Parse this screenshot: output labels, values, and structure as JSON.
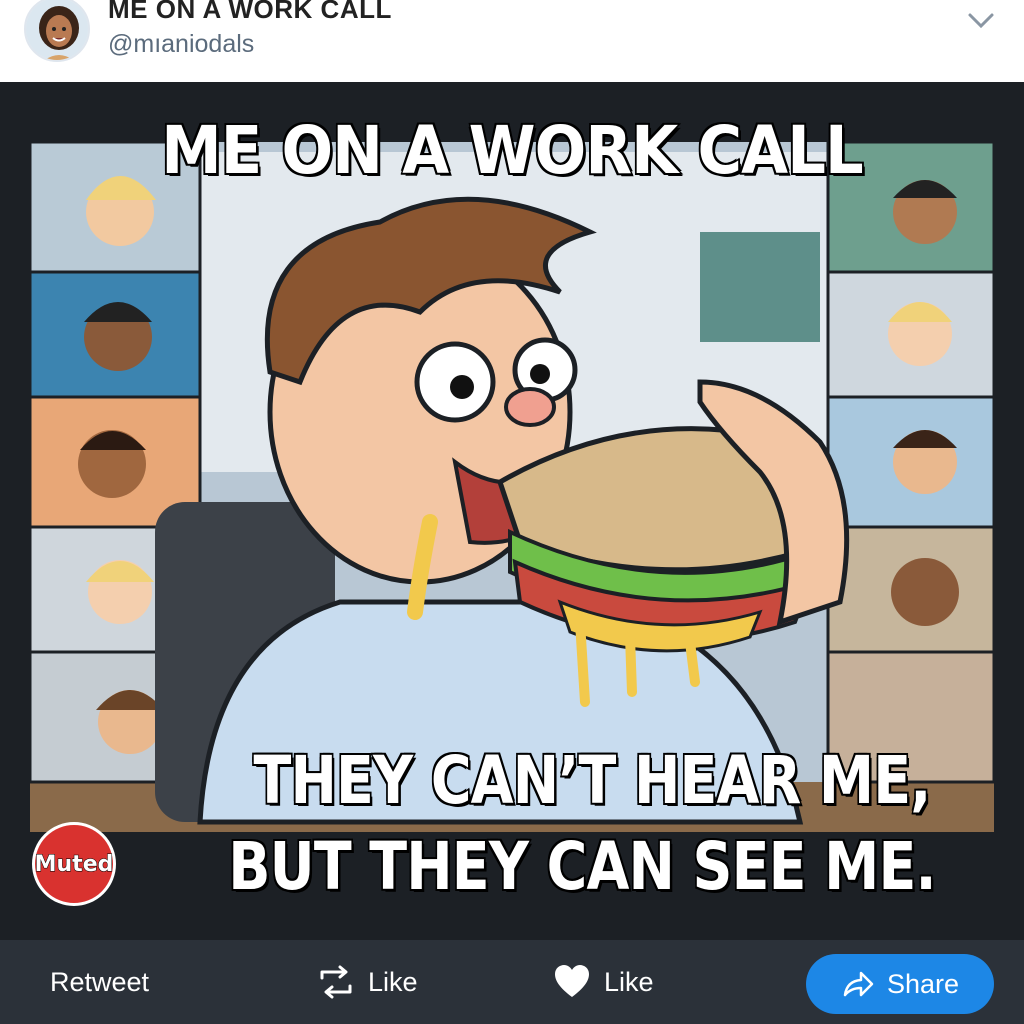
{
  "header": {
    "display_name": "ME ON A WORK CALL",
    "handle": "@mıaniodals",
    "avatar_icon": "woman-avatar",
    "menu_icon": "chevron-down-icon"
  },
  "meme": {
    "caption_top": "ME ON A WORK CALL",
    "caption_bottom_line1": "THEY CAN’T HEAR ME,",
    "caption_bottom_line2": "BUT THEY CAN SEE ME.",
    "muted_badge": "Muted",
    "accent_red": "#d9322f"
  },
  "actions": {
    "retweet_label": "Retweet",
    "like_label_1": "Like",
    "like_label_2": "Like",
    "share_label": "Share",
    "share_color": "#1d87e6"
  }
}
